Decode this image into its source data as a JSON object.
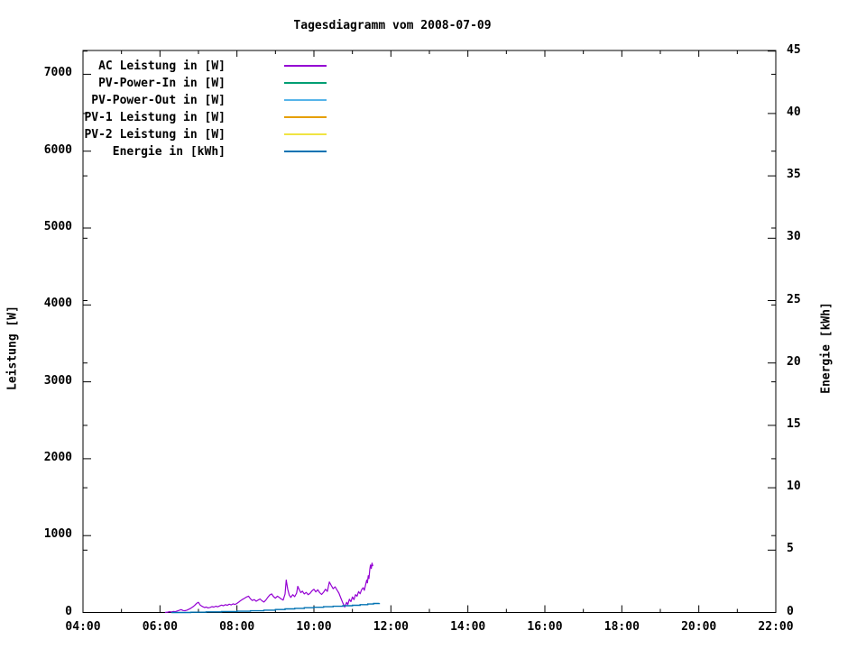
{
  "title": "Tagesdiagramm vom 2008-07-09",
  "axes": {
    "x": {
      "major": [
        {
          "hour": 4,
          "label": "04:00"
        },
        {
          "hour": 6,
          "label": "06:00"
        },
        {
          "hour": 8,
          "label": "08:00"
        },
        {
          "hour": 10,
          "label": "10:00"
        },
        {
          "hour": 12,
          "label": "12:00"
        },
        {
          "hour": 14,
          "label": "14:00"
        },
        {
          "hour": 16,
          "label": "16:00"
        },
        {
          "hour": 18,
          "label": "18:00"
        },
        {
          "hour": 20,
          "label": "20:00"
        },
        {
          "hour": 22,
          "label": "22:00"
        }
      ],
      "minor_hours": [
        5,
        7,
        9,
        11,
        13,
        15,
        17,
        19,
        21
      ]
    },
    "left": {
      "label": "Leistung [W]",
      "ticks": [
        {
          "value": 0,
          "label": "0"
        },
        {
          "value": 1000,
          "label": "1000"
        },
        {
          "value": 2000,
          "label": "2000"
        },
        {
          "value": 3000,
          "label": "3000"
        },
        {
          "value": 4000,
          "label": "4000"
        },
        {
          "value": 5000,
          "label": "5000"
        },
        {
          "value": 6000,
          "label": "6000"
        },
        {
          "value": 7000,
          "label": "7000"
        }
      ]
    },
    "right": {
      "label": "Energie [kWh]",
      "ticks": [
        {
          "value": 0,
          "label": "0"
        },
        {
          "value": 5,
          "label": "5"
        },
        {
          "value": 10,
          "label": "10"
        },
        {
          "value": 15,
          "label": "15"
        },
        {
          "value": 20,
          "label": "20"
        },
        {
          "value": 25,
          "label": "25"
        },
        {
          "value": 30,
          "label": "30"
        },
        {
          "value": 35,
          "label": "35"
        },
        {
          "value": 40,
          "label": "40"
        },
        {
          "value": 45,
          "label": "45"
        }
      ]
    }
  },
  "legend": {
    "entries": [
      {
        "label": "AC Leistung in [W]",
        "color": "#9400D3"
      },
      {
        "label": "PV-Power-In in [W]",
        "color": "#009E73"
      },
      {
        "label": "PV-Power-Out in [W]",
        "color": "#56B4E9"
      },
      {
        "label": "PV-1 Leistung in [W]",
        "color": "#E69F00"
      },
      {
        "label": "PV-2 Leistung in [W]",
        "color": "#F0E442"
      },
      {
        "label": "Energie in [kWh]",
        "color": "#0072B2"
      }
    ]
  },
  "chart_data": {
    "type": "line",
    "title": "Tagesdiagramm vom 2008-07-09",
    "xlabel": "",
    "ylabel_left": "Leistung [W]",
    "ylabel_right": "Energie [kWh]",
    "x_range_hours": [
      4,
      22
    ],
    "y_left_range": [
      0,
      7300
    ],
    "y_right_range": [
      0,
      45
    ],
    "grid": false,
    "legend_position": "top-left-inside",
    "series": [
      {
        "name": "AC Leistung in [W]",
        "color": "#9400D3",
        "axis": "left",
        "style": "line",
        "points": [
          [
            6.13,
            0
          ],
          [
            6.2,
            5
          ],
          [
            6.25,
            10
          ],
          [
            6.3,
            6
          ],
          [
            6.35,
            14
          ],
          [
            6.4,
            10
          ],
          [
            6.45,
            20
          ],
          [
            6.5,
            28
          ],
          [
            6.55,
            38
          ],
          [
            6.6,
            26
          ],
          [
            6.65,
            24
          ],
          [
            6.7,
            30
          ],
          [
            6.75,
            42
          ],
          [
            6.8,
            55
          ],
          [
            6.85,
            72
          ],
          [
            6.9,
            92
          ],
          [
            6.95,
            118
          ],
          [
            7.0,
            132
          ],
          [
            7.04,
            100
          ],
          [
            7.08,
            84
          ],
          [
            7.12,
            74
          ],
          [
            7.16,
            64
          ],
          [
            7.2,
            72
          ],
          [
            7.25,
            60
          ],
          [
            7.3,
            66
          ],
          [
            7.35,
            76
          ],
          [
            7.4,
            70
          ],
          [
            7.45,
            82
          ],
          [
            7.5,
            74
          ],
          [
            7.55,
            86
          ],
          [
            7.6,
            96
          ],
          [
            7.65,
            88
          ],
          [
            7.7,
            102
          ],
          [
            7.75,
            94
          ],
          [
            7.8,
            108
          ],
          [
            7.85,
            98
          ],
          [
            7.9,
            112
          ],
          [
            7.95,
            104
          ],
          [
            8.0,
            118
          ],
          [
            8.05,
            136
          ],
          [
            8.1,
            156
          ],
          [
            8.15,
            172
          ],
          [
            8.2,
            186
          ],
          [
            8.25,
            202
          ],
          [
            8.3,
            212
          ],
          [
            8.35,
            178
          ],
          [
            8.4,
            156
          ],
          [
            8.45,
            168
          ],
          [
            8.5,
            146
          ],
          [
            8.55,
            162
          ],
          [
            8.6,
            176
          ],
          [
            8.65,
            152
          ],
          [
            8.7,
            136
          ],
          [
            8.75,
            162
          ],
          [
            8.8,
            196
          ],
          [
            8.85,
            226
          ],
          [
            8.9,
            242
          ],
          [
            8.95,
            206
          ],
          [
            9.0,
            186
          ],
          [
            9.05,
            212
          ],
          [
            9.1,
            196
          ],
          [
            9.15,
            176
          ],
          [
            9.2,
            162
          ],
          [
            9.25,
            240
          ],
          [
            9.28,
            422
          ],
          [
            9.32,
            300
          ],
          [
            9.36,
            225
          ],
          [
            9.4,
            196
          ],
          [
            9.45,
            232
          ],
          [
            9.5,
            206
          ],
          [
            9.55,
            252
          ],
          [
            9.58,
            340
          ],
          [
            9.62,
            296
          ],
          [
            9.66,
            258
          ],
          [
            9.7,
            278
          ],
          [
            9.75,
            242
          ],
          [
            9.8,
            262
          ],
          [
            9.85,
            232
          ],
          [
            9.9,
            248
          ],
          [
            9.95,
            282
          ],
          [
            10.0,
            302
          ],
          [
            10.05,
            268
          ],
          [
            10.1,
            296
          ],
          [
            10.15,
            258
          ],
          [
            10.2,
            234
          ],
          [
            10.25,
            264
          ],
          [
            10.3,
            302
          ],
          [
            10.35,
            274
          ],
          [
            10.4,
            398
          ],
          [
            10.45,
            352
          ],
          [
            10.5,
            310
          ],
          [
            10.55,
            334
          ],
          [
            10.6,
            292
          ],
          [
            10.65,
            252
          ],
          [
            10.7,
            186
          ],
          [
            10.75,
            126
          ],
          [
            10.8,
            70
          ],
          [
            10.85,
            132
          ],
          [
            10.88,
            102
          ],
          [
            10.92,
            172
          ],
          [
            10.96,
            142
          ],
          [
            11.0,
            202
          ],
          [
            11.04,
            168
          ],
          [
            11.08,
            232
          ],
          [
            11.12,
            212
          ],
          [
            11.16,
            272
          ],
          [
            11.2,
            244
          ],
          [
            11.24,
            298
          ],
          [
            11.28,
            322
          ],
          [
            11.31,
            288
          ],
          [
            11.34,
            356
          ],
          [
            11.37,
            422
          ],
          [
            11.39,
            386
          ],
          [
            11.41,
            478
          ],
          [
            11.43,
            442
          ],
          [
            11.45,
            558
          ],
          [
            11.47,
            618
          ],
          [
            11.49,
            572
          ],
          [
            11.51,
            642
          ],
          [
            11.53,
            602
          ]
        ]
      },
      {
        "name": "PV-Power-In in [W]",
        "color": "#009E73",
        "axis": "left",
        "style": "line",
        "points": []
      },
      {
        "name": "PV-Power-Out in [W]",
        "color": "#56B4E9",
        "axis": "left",
        "style": "line",
        "points": []
      },
      {
        "name": "PV-1 Leistung in [W]",
        "color": "#E69F00",
        "axis": "left",
        "style": "line",
        "points": []
      },
      {
        "name": "PV-2 Leistung in [W]",
        "color": "#F0E442",
        "axis": "left",
        "style": "line",
        "points": []
      },
      {
        "name": "Energie in [kWh]",
        "color": "#0072B2",
        "axis": "right",
        "style": "steps",
        "points": [
          [
            6.3,
            0.0
          ],
          [
            6.8,
            0.02
          ],
          [
            7.2,
            0.05
          ],
          [
            7.6,
            0.08
          ],
          [
            8.0,
            0.1
          ],
          [
            8.35,
            0.14
          ],
          [
            8.7,
            0.19
          ],
          [
            9.0,
            0.24
          ],
          [
            9.25,
            0.29
          ],
          [
            9.5,
            0.33
          ],
          [
            9.75,
            0.38
          ],
          [
            10.0,
            0.42
          ],
          [
            10.25,
            0.46
          ],
          [
            10.5,
            0.5
          ],
          [
            10.75,
            0.54
          ],
          [
            11.0,
            0.58
          ],
          [
            11.2,
            0.63
          ],
          [
            11.4,
            0.68
          ],
          [
            11.55,
            0.72
          ],
          [
            11.7,
            0.75
          ]
        ]
      }
    ]
  }
}
